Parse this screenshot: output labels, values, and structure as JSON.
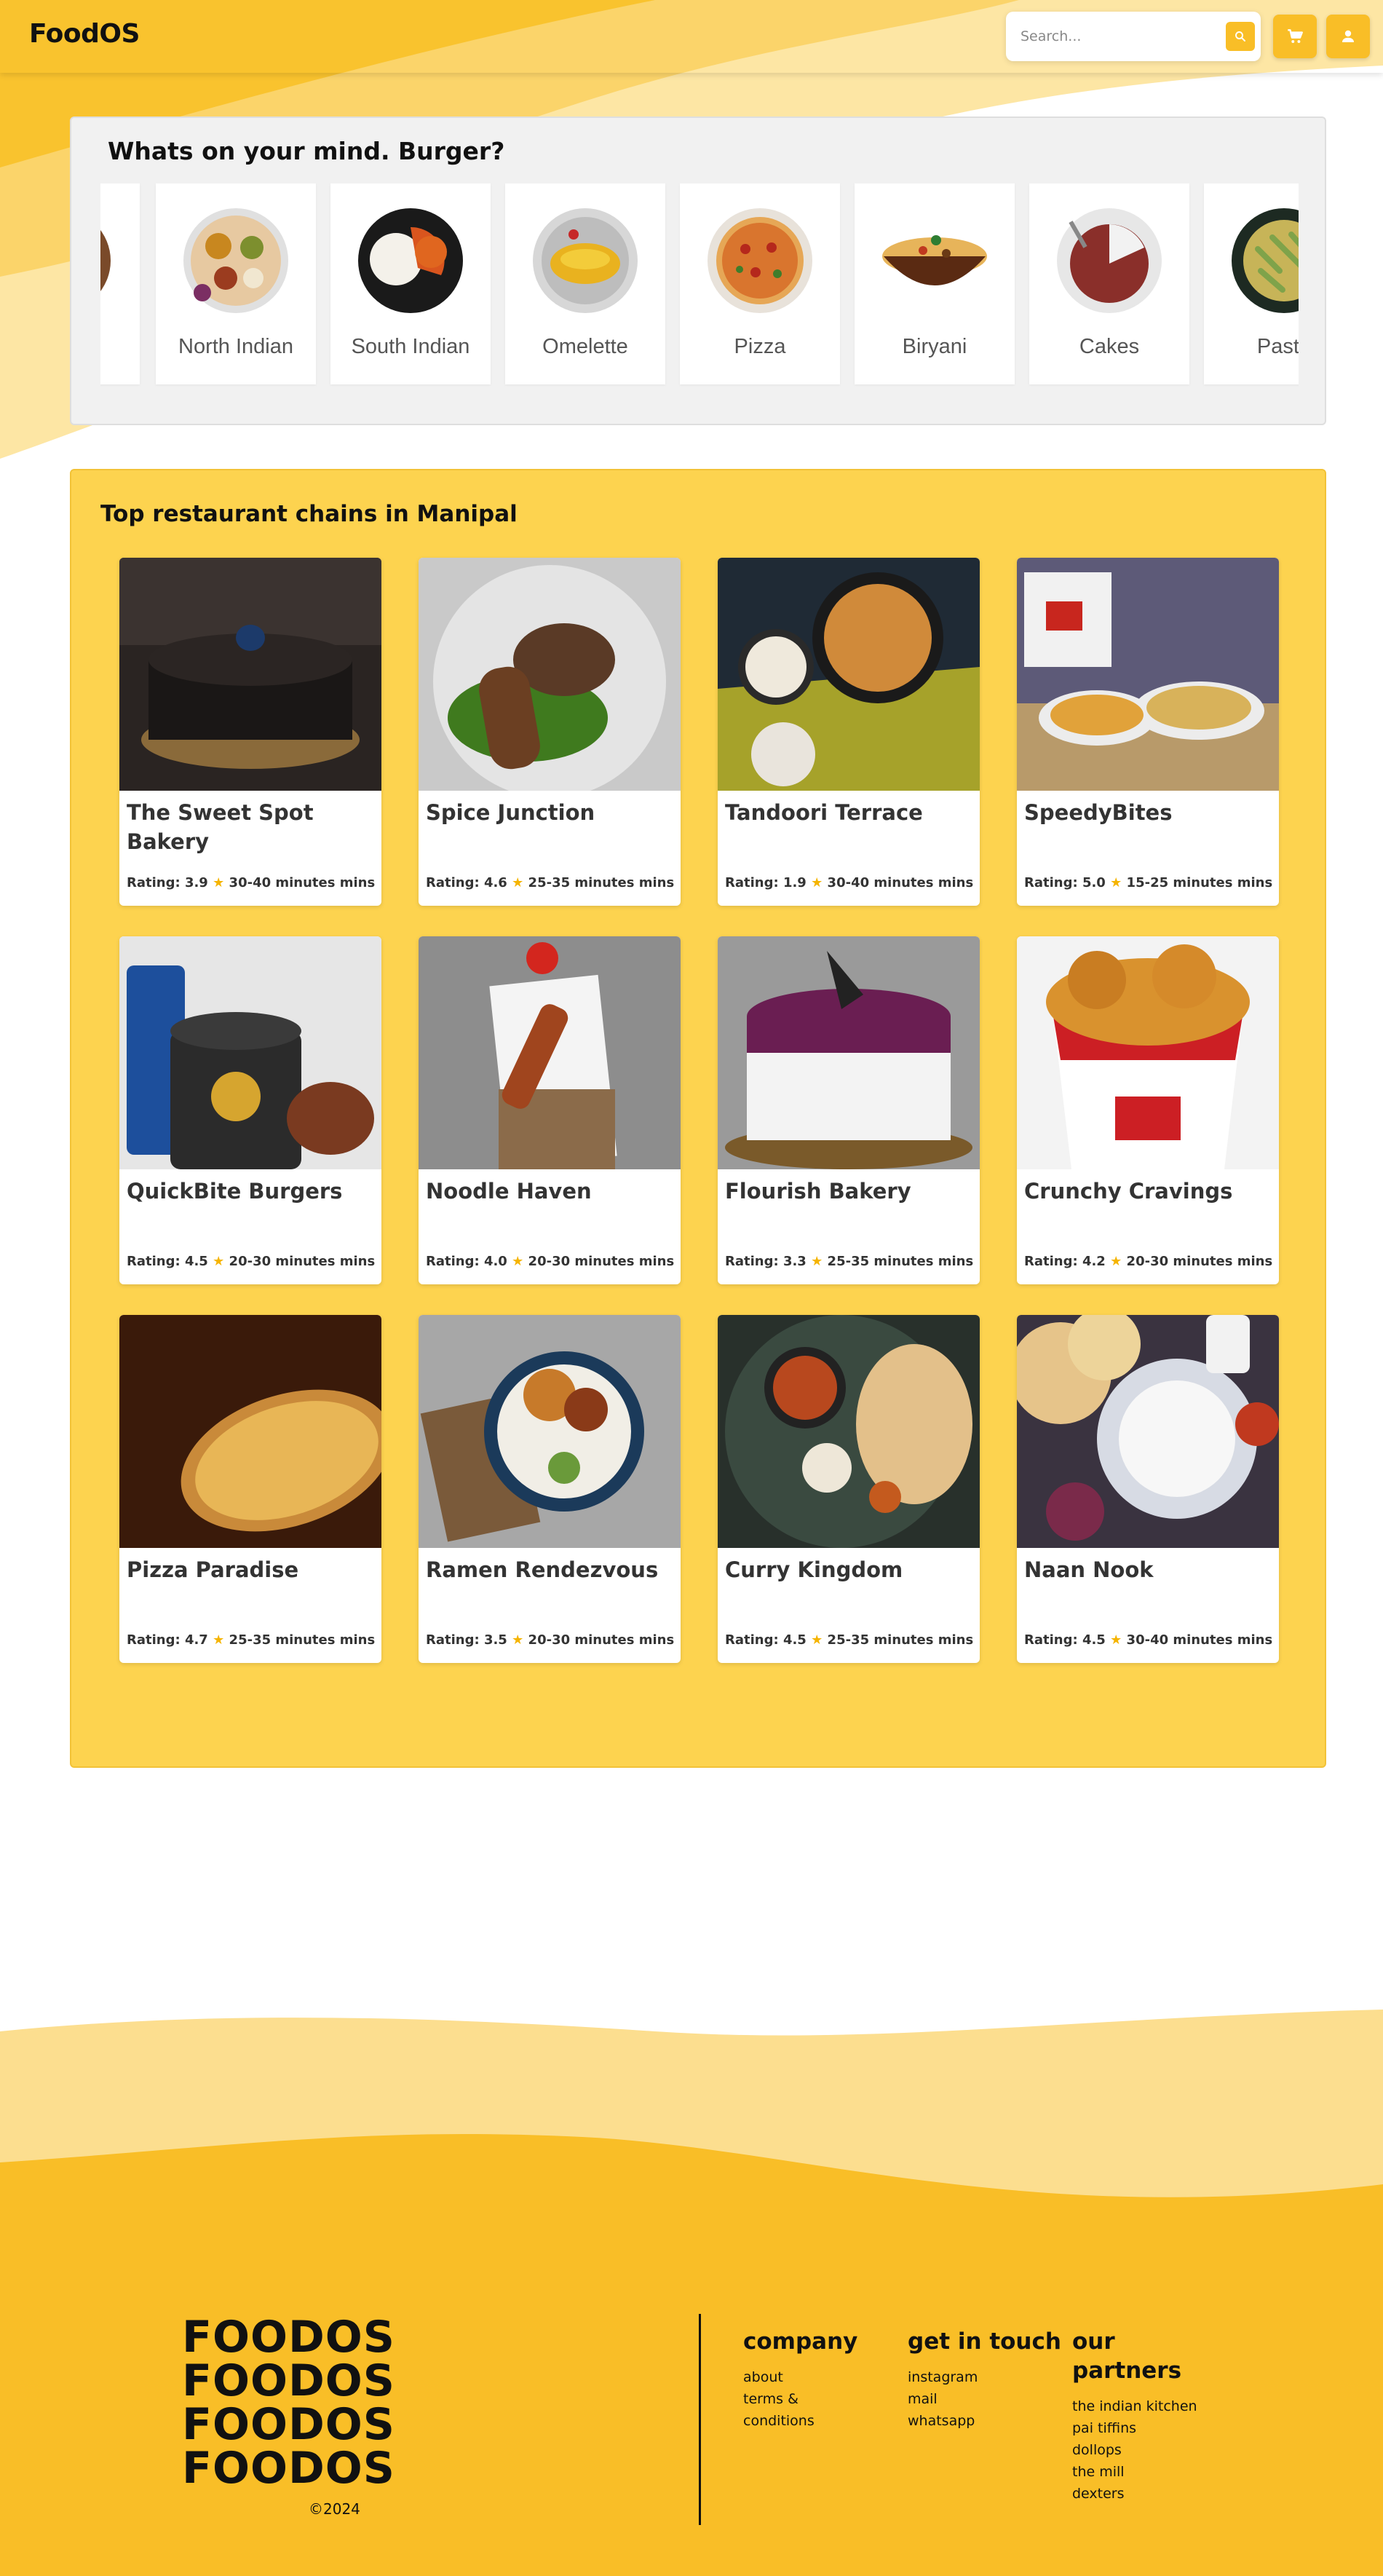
{
  "header": {
    "logo": "FoodOS",
    "search_placeholder": "Search...",
    "search_icon": "search-icon",
    "cart_icon": "cart-icon",
    "profile_icon": "user-icon",
    "accent_color": "#f9be27"
  },
  "categories": {
    "title": "Whats on your mind. Burger?",
    "items": [
      {
        "label": "North Indian"
      },
      {
        "label": "South Indian"
      },
      {
        "label": "Omelette"
      },
      {
        "label": "Pizza"
      },
      {
        "label": "Biryani"
      },
      {
        "label": "Cakes"
      },
      {
        "label": "Pasta"
      }
    ]
  },
  "restaurants": {
    "title": "Top restaurant chains in Manipal",
    "items": [
      {
        "name": "The Sweet Spot Bakery",
        "rating_label": "Rating: 3.9",
        "time": "30-40 minutes mins"
      },
      {
        "name": "Spice Junction",
        "rating_label": "Rating: 4.6",
        "time": "25-35 minutes mins"
      },
      {
        "name": "Tandoori Terrace",
        "rating_label": "Rating: 1.9",
        "time": "30-40 minutes mins"
      },
      {
        "name": "SpeedyBites",
        "rating_label": "Rating: 5.0",
        "time": "15-25 minutes mins"
      },
      {
        "name": "QuickBite Burgers",
        "rating_label": "Rating: 4.5",
        "time": "20-30 minutes mins"
      },
      {
        "name": "Noodle Haven",
        "rating_label": "Rating: 4.0",
        "time": "20-30 minutes mins"
      },
      {
        "name": "Flourish Bakery",
        "rating_label": "Rating: 3.3",
        "time": "25-35 minutes mins"
      },
      {
        "name": "Crunchy Cravings",
        "rating_label": "Rating: 4.2",
        "time": "20-30 minutes mins"
      },
      {
        "name": "Pizza Paradise",
        "rating_label": "Rating: 4.7",
        "time": "25-35 minutes mins"
      },
      {
        "name": "Ramen Rendezvous",
        "rating_label": "Rating: 3.5",
        "time": "20-30 minutes mins"
      },
      {
        "name": "Curry Kingdom",
        "rating_label": "Rating: 4.5",
        "time": "25-35 minutes mins"
      },
      {
        "name": "Naan Nook",
        "rating_label": "Rating: 4.5",
        "time": "30-40 minutes mins"
      }
    ]
  },
  "footer": {
    "brand_repeat": [
      "FOODOS",
      "FOODOS",
      "FOODOS",
      "FOODOS"
    ],
    "copyright": "©2024",
    "company": {
      "title": "company",
      "links": [
        "about",
        "terms &",
        "conditions"
      ]
    },
    "contact": {
      "title": "get in touch",
      "links": [
        "instagram",
        "mail",
        "whatsapp"
      ]
    },
    "partners": {
      "title_line1": "our",
      "title_line2": "partners",
      "links": [
        "the indian kitchen",
        "pai tiffins",
        "dollops",
        "the mill",
        "dexters"
      ]
    }
  }
}
